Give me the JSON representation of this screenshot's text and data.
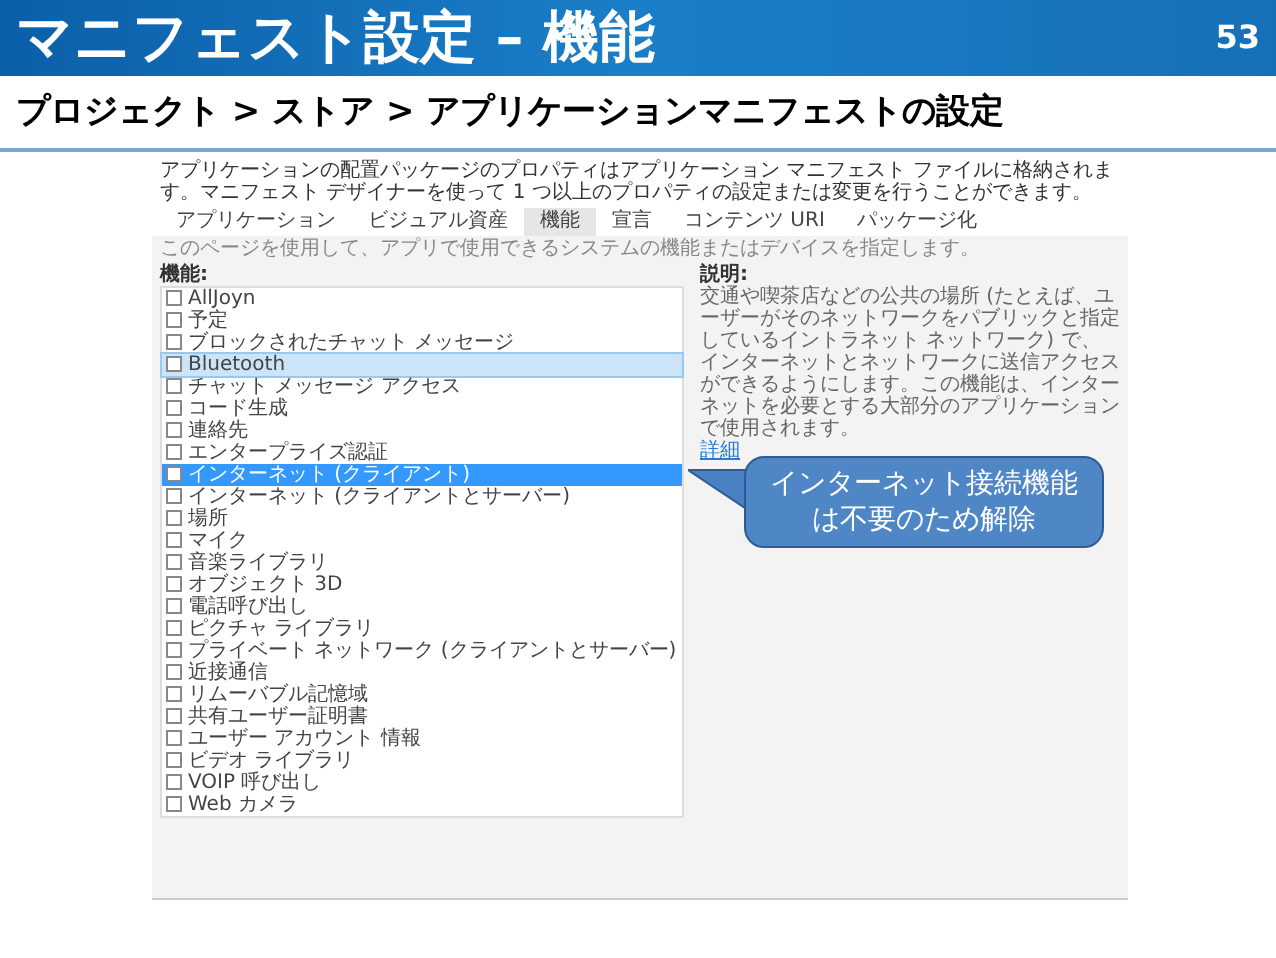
{
  "slide": {
    "title": "マニフェスト設定 – 機能",
    "page_number": "53",
    "subtitle": "プロジェクト > ストア > アプリケーションマニフェストの設定"
  },
  "designer": {
    "intro": "アプリケーションの配置パッケージのプロパティはアプリケーション マニフェスト ファイルに格納されます。マニフェスト デザイナーを使って 1 つ以上のプロパティの設定または変更を行うことができます。",
    "tabs": [
      {
        "label": "アプリケーション",
        "selected": false
      },
      {
        "label": "ビジュアル資産",
        "selected": false
      },
      {
        "label": "機能",
        "selected": true
      },
      {
        "label": "宣言",
        "selected": false
      },
      {
        "label": "コンテンツ URI",
        "selected": false
      },
      {
        "label": "パッケージ化",
        "selected": false
      }
    ],
    "page_hint": "このページを使用して、アプリで使用できるシステムの機能またはデバイスを指定します。",
    "capabilities_label": "機能:",
    "capabilities": [
      {
        "label": "AllJoyn",
        "checked": false,
        "selected": false,
        "hovered": false
      },
      {
        "label": "予定",
        "checked": false,
        "selected": false,
        "hovered": false
      },
      {
        "label": "ブロックされたチャット メッセージ",
        "checked": false,
        "selected": false,
        "hovered": false
      },
      {
        "label": "Bluetooth",
        "checked": false,
        "selected": false,
        "hovered": true
      },
      {
        "label": "チャット メッセージ アクセス",
        "checked": false,
        "selected": false,
        "hovered": false
      },
      {
        "label": "コード生成",
        "checked": false,
        "selected": false,
        "hovered": false
      },
      {
        "label": "連絡先",
        "checked": false,
        "selected": false,
        "hovered": false
      },
      {
        "label": "エンタープライズ認証",
        "checked": false,
        "selected": false,
        "hovered": false
      },
      {
        "label": "インターネット (クライアント)",
        "checked": false,
        "selected": true,
        "hovered": false
      },
      {
        "label": "インターネット (クライアントとサーバー)",
        "checked": false,
        "selected": false,
        "hovered": false
      },
      {
        "label": "場所",
        "checked": false,
        "selected": false,
        "hovered": false
      },
      {
        "label": "マイク",
        "checked": false,
        "selected": false,
        "hovered": false
      },
      {
        "label": "音楽ライブラリ",
        "checked": false,
        "selected": false,
        "hovered": false
      },
      {
        "label": "オブジェクト 3D",
        "checked": false,
        "selected": false,
        "hovered": false
      },
      {
        "label": "電話呼び出し",
        "checked": false,
        "selected": false,
        "hovered": false
      },
      {
        "label": "ピクチャ ライブラリ",
        "checked": false,
        "selected": false,
        "hovered": false
      },
      {
        "label": "プライベート ネットワーク (クライアントとサーバー)",
        "checked": false,
        "selected": false,
        "hovered": false
      },
      {
        "label": "近接通信",
        "checked": false,
        "selected": false,
        "hovered": false
      },
      {
        "label": "リムーバブル記憶域",
        "checked": false,
        "selected": false,
        "hovered": false
      },
      {
        "label": "共有ユーザー証明書",
        "checked": false,
        "selected": false,
        "hovered": false
      },
      {
        "label": "ユーザー アカウント 情報",
        "checked": false,
        "selected": false,
        "hovered": false
      },
      {
        "label": "ビデオ ライブラリ",
        "checked": false,
        "selected": false,
        "hovered": false
      },
      {
        "label": "VOIP 呼び出し",
        "checked": false,
        "selected": false,
        "hovered": false
      },
      {
        "label": "Web カメラ",
        "checked": false,
        "selected": false,
        "hovered": false
      }
    ],
    "description_label": "説明:",
    "description": "交通や喫茶店などの公共の場所 (たとえば、ユーザーがそのネットワークをパブリックと指定しているイントラネット ネットワーク) で、インターネットとネットワークに送信アクセスができるようにします。この機能は、インターネットを必要とする大部分のアプリケーションで使用されます。",
    "details_link": "詳細"
  },
  "callout": {
    "lines": [
      "インターネット接続機能",
      "は不要のため解除"
    ]
  }
}
